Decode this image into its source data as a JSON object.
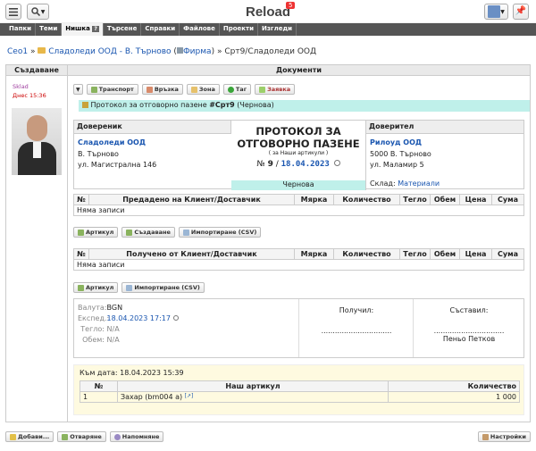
{
  "app": {
    "title": "Reload",
    "notification_count": "5"
  },
  "tabs": [
    "Папки",
    "Теми",
    "Нишка",
    "Търсене",
    "Справки",
    "Файлове",
    "Проекти",
    "Изгледи"
  ],
  "active_tab_help": "?",
  "breadcrumb": {
    "root": "Сео1",
    "sep1": "»",
    "company": "Сладоледи ООД - В. Търново",
    "type_open": "(",
    "type": "Фирма",
    "type_close": ")",
    "sep2": "»",
    "current": "Срт9/Сладоледи ООД"
  },
  "columns": {
    "creation": "Създаване",
    "documents": "Документи"
  },
  "creator": {
    "name": "Sklad",
    "date": "Днес 15:36"
  },
  "toolbar": {
    "transport": "Транспорт",
    "link": "Връзка",
    "zone": "Зона",
    "tag": "Таг",
    "request": "Заявка"
  },
  "note": {
    "prefix": "Протокол за отговорно пазене",
    "number": "#Срт9",
    "status": "(Чернова)"
  },
  "depositor": {
    "label": "Довереник",
    "name": "Сладоледи ООД",
    "city": "В. Търново",
    "street": "ул. Магистрална 146"
  },
  "protocol": {
    "title1": "ПРОТОКОЛ ЗА",
    "title2": "ОТГОВОРНО ПАЗЕНЕ",
    "subtitle": "( за Наши артикули )",
    "no_label": "№",
    "no": "9",
    "slash": "/",
    "date": "18.04.2023",
    "status": "Чернова"
  },
  "trustee": {
    "label": "Доверител",
    "name": "Рилоуд ООД",
    "city": "5000 В. Търново",
    "street": "ул. Маламир 5",
    "warehouse_label": "Склад:",
    "warehouse": "Материали"
  },
  "table_handed": {
    "headers": [
      "№",
      "Предадено на Клиент/Доставчик",
      "Мярка",
      "Количество",
      "Тегло",
      "Обем",
      "Цена",
      "Сума"
    ],
    "empty": "Няма записи"
  },
  "table_received": {
    "headers": [
      "№",
      "Получено от Клиент/Доставчик",
      "Мярка",
      "Количество",
      "Тегло",
      "Обем",
      "Цена",
      "Сума"
    ],
    "empty": "Няма записи"
  },
  "btns1": {
    "article": "Артикул",
    "create": "Създаване",
    "import": "Импортиране (CSV)"
  },
  "btns2": {
    "article": "Артикул",
    "import": "Импортиране (CSV)"
  },
  "footer_info": {
    "currency_label": "Валута:",
    "currency": "BGN",
    "expedition_label": "Експед.:",
    "expedition": "18.04.2023 17:17",
    "weight_label": "Тегло:",
    "weight": "N/A",
    "volume_label": "Обем:",
    "volume": "N/A",
    "received_label": "Получил:",
    "received_line": "...............................",
    "composed_label": "Съставил:",
    "composed_line": "...............................",
    "composer": "Пеньо Петков"
  },
  "stock": {
    "date_label": "Към дата:",
    "date": "18.04.2023 15:39",
    "headers": [
      "№",
      "Наш артикул",
      "Количество"
    ],
    "rows": [
      {
        "no": "1",
        "article": "Захар (bm004 а)",
        "qty": "1 000"
      }
    ]
  },
  "bottom": {
    "add": "Добави...",
    "open": "Отваряне",
    "reminder": "Напомняне",
    "settings": "Настройки"
  }
}
